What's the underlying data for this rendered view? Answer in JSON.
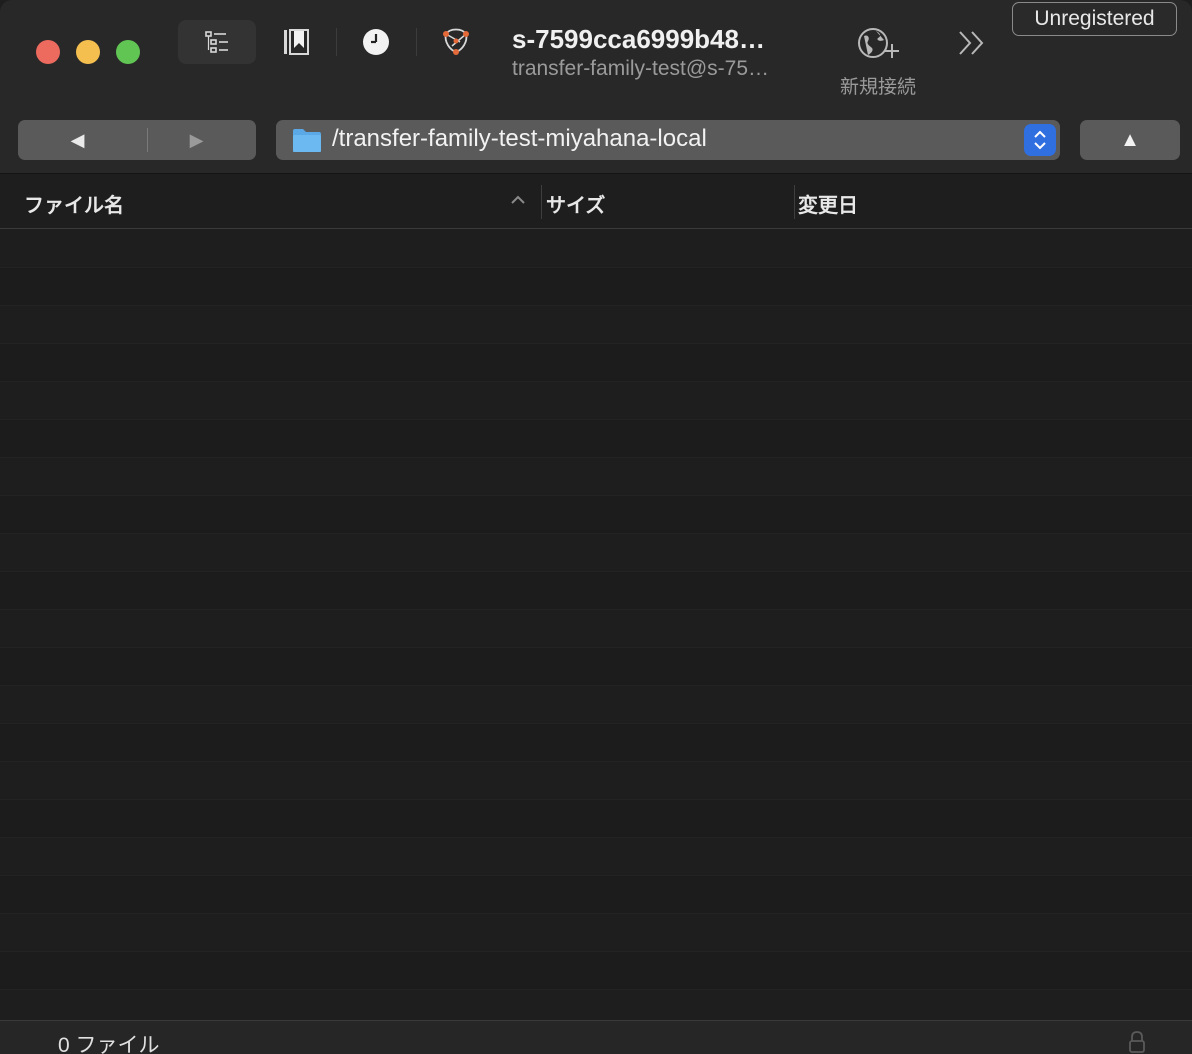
{
  "window": {
    "connection_title": "s-7599cca6999b48…",
    "connection_subtitle": "transfer-family-test@s-75…",
    "new_connection_label": "新規接続",
    "unregistered_label": "Unregistered"
  },
  "toolbar": {
    "icons": [
      "outline-view-icon",
      "bookmark-icon",
      "history-clock-icon",
      "bonjour-network-icon",
      "globe-plus-icon",
      "overflow-chevrons-icon"
    ]
  },
  "navigation": {
    "path": "/transfer-family-test-miyahana-local",
    "back_symbol": "◀",
    "forward_symbol": "▶",
    "up_symbol": "▲"
  },
  "columns": {
    "name": "ファイル名",
    "size": "サイズ",
    "modified": "変更日",
    "sort": "ascending"
  },
  "files": [],
  "status": {
    "file_count": "0 ファイル"
  },
  "colors": {
    "close": "#ec6a5e",
    "minimize": "#f4bf4f",
    "maximize": "#61c554",
    "accent": "#2f6fe0",
    "folder": "#5aa9e6"
  }
}
